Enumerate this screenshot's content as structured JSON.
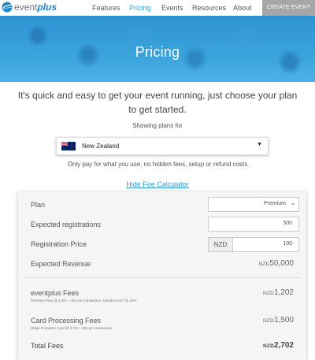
{
  "header": {
    "logo": {
      "event": "event",
      "plus": "plus"
    },
    "nav": [
      "Features",
      "Pricing",
      "Events",
      "Resources",
      "About"
    ],
    "active_nav": "Pricing",
    "create_event": "CREATE EVENT"
  },
  "hero": {
    "title": "Pricing"
  },
  "intro": "It's quick and easy to get your event running, just choose your plan to get started.",
  "showing_plans_for": "Showing plans for",
  "country": {
    "selected": "New Zealand"
  },
  "only_pay": "Only pay for what you use, no hidden fees, setup or refund costs",
  "hide_fee_calculator": "Hide Fee Calculator",
  "calculator": {
    "plan": {
      "label": "Plan",
      "value": "Premium"
    },
    "expected_registrations": {
      "label": "Expected registrations",
      "value": "500"
    },
    "registration_price": {
      "label": "Registration Price",
      "currency": "NZD",
      "value": "100"
    },
    "expected_revenue": {
      "label": "Expected Revenue",
      "currency": "NZD",
      "amount": "50,000"
    },
    "eventplus_fees": {
      "label": "eventplus Fees",
      "note": "Premium Plan @ 1.6% + 49c per transaction, includes GST @ 15%",
      "currency": "NZD",
      "amount": "1,202"
    },
    "card_processing_fees": {
      "label": "Card Processing Fees",
      "note": "Stripe Domestic Card @ 2.7% + 30c per transaction",
      "currency": "NZD",
      "amount": "1,500"
    },
    "total_fees": {
      "label": "Total Fees",
      "currency": "NZD",
      "amount": "2,702"
    }
  },
  "colors": {
    "brand_blue": "#2d8fd0",
    "link_blue": "#2d9ad6",
    "create_btn": "#a6a6a6"
  }
}
